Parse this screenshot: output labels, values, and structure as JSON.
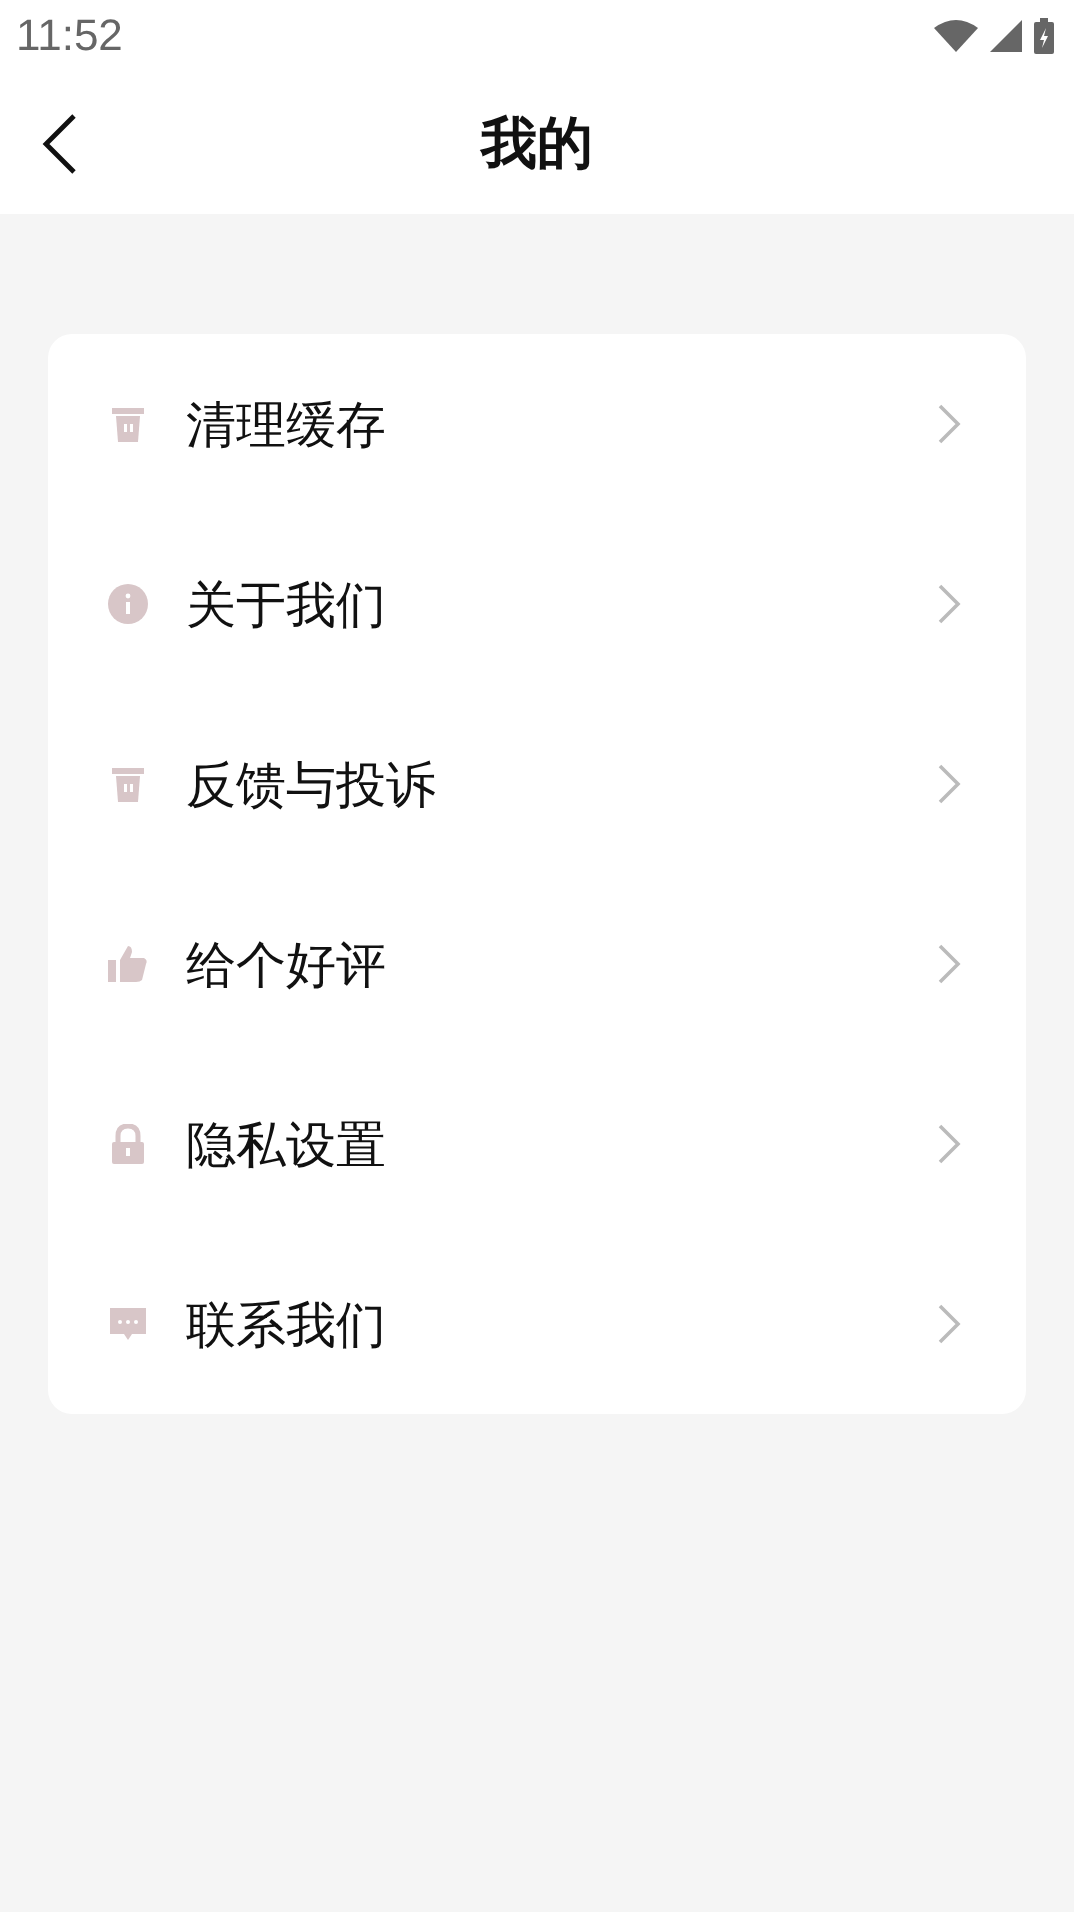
{
  "status_bar": {
    "time": "11:52"
  },
  "header": {
    "title": "我的"
  },
  "menu": [
    {
      "label": "清理缓存"
    },
    {
      "label": "关于我们"
    },
    {
      "label": "反馈与投诉"
    },
    {
      "label": "给个好评"
    },
    {
      "label": "隐私设置"
    },
    {
      "label": "联系我们"
    }
  ]
}
